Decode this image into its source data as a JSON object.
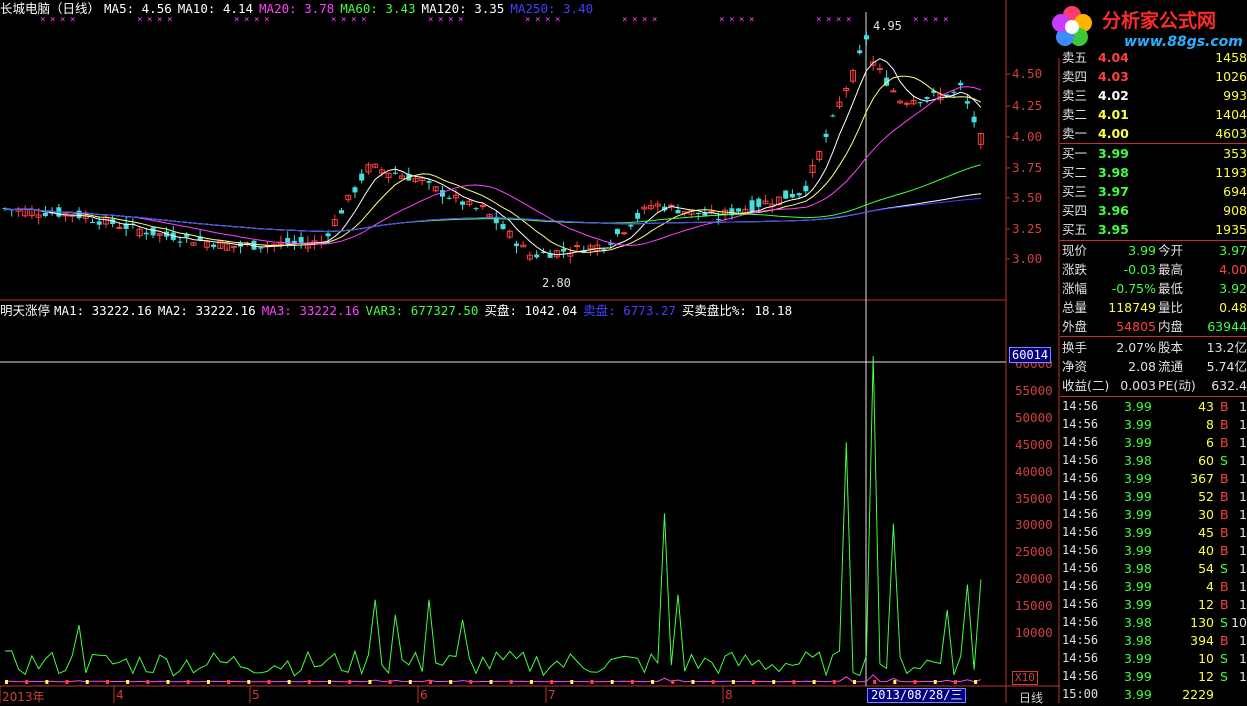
{
  "header": {
    "title": "长城电脑（日线）",
    "ma": [
      {
        "label": "MA5: 4.56",
        "color": "#ffffff"
      },
      {
        "label": "MA10: 4.14",
        "color": "#ffffff"
      },
      {
        "label": "MA20: 3.78",
        "color": "#ff40ff"
      },
      {
        "label": "MA60: 3.43",
        "color": "#40ff40"
      },
      {
        "label": "MA120: 3.35",
        "color": "#ffffff"
      },
      {
        "label": "MA250: 3.40",
        "color": "#4040ff"
      }
    ]
  },
  "indicator": {
    "name": "明天涨停",
    "items": [
      {
        "label": "MA1: 33222.16",
        "color": "#ffffff"
      },
      {
        "label": "MA2: 33222.16",
        "color": "#ffffff"
      },
      {
        "label": "MA3: 33222.16",
        "color": "#ff40ff"
      },
      {
        "label": "VAR3: 677327.50",
        "color": "#40ff40"
      },
      {
        "label": "买盘: 1042.04",
        "color": "#ffffff"
      },
      {
        "label": "卖盘: 6773.27",
        "color": "#4040ff"
      },
      {
        "label": "买卖盘比%: 18.18",
        "color": "#ffffff"
      }
    ]
  },
  "price_axis": [
    "4.50",
    "4.25",
    "4.00",
    "3.75",
    "3.50",
    "3.25",
    "3.00"
  ],
  "volume_axis": [
    "60000",
    "55000",
    "50000",
    "45000",
    "40000",
    "35000",
    "30000",
    "25000",
    "20000",
    "15000",
    "10000"
  ],
  "crosshair_value": "60014",
  "zoom_label": "X10",
  "period_label": "日线",
  "x_axis": [
    "2013年",
    "4",
    "5",
    "6",
    "7",
    "8"
  ],
  "cursor_date": "2013/08/28/三",
  "annotations": {
    "high": "4.95",
    "low": "2.80"
  },
  "logo": {
    "name": "分析家公式网",
    "url": "www.88gs.com"
  },
  "order_book": {
    "sell": [
      {
        "label": "卖五",
        "price": "4.04",
        "vol": "1458"
      },
      {
        "label": "卖四",
        "price": "4.03",
        "vol": "1026"
      },
      {
        "label": "卖三",
        "price": "4.02",
        "vol": "993"
      },
      {
        "label": "卖二",
        "price": "4.01",
        "vol": "1404"
      },
      {
        "label": "卖一",
        "price": "4.00",
        "vol": "4603"
      }
    ],
    "buy": [
      {
        "label": "买一",
        "price": "3.99",
        "vol": "353"
      },
      {
        "label": "买二",
        "price": "3.98",
        "vol": "1193"
      },
      {
        "label": "买三",
        "price": "3.97",
        "vol": "694"
      },
      {
        "label": "买四",
        "price": "3.96",
        "vol": "908"
      },
      {
        "label": "买五",
        "price": "3.95",
        "vol": "1935"
      }
    ]
  },
  "quote": [
    {
      "l1": "现价",
      "v1": "3.99",
      "c1": "#40ff40",
      "l2": "今开",
      "v2": "3.97",
      "c2": "#40ff40"
    },
    {
      "l1": "涨跌",
      "v1": "-0.03",
      "c1": "#40ff40",
      "l2": "最高",
      "v2": "4.00",
      "c2": "#ff4040"
    },
    {
      "l1": "涨幅",
      "v1": "-0.75%",
      "c1": "#40ff40",
      "l2": "最低",
      "v2": "3.92",
      "c2": "#40ff40"
    },
    {
      "l1": "总量",
      "v1": "118749",
      "c1": "#ffff40",
      "l2": "量比",
      "v2": "0.48",
      "c2": "#ffff40"
    },
    {
      "l1": "外盘",
      "v1": "54805",
      "c1": "#ff4040",
      "l2": "内盘",
      "v2": "63944",
      "c2": "#40ff40"
    }
  ],
  "stats": [
    {
      "l1": "换手",
      "v1": "2.07%",
      "l2": "股本",
      "v2": "13.2亿"
    },
    {
      "l1": "净资",
      "v1": "2.08",
      "l2": "流通",
      "v2": "5.74亿"
    },
    {
      "l1": "收益(二)",
      "v1": "0.003",
      "l2": "PE(动)",
      "v2": "632.4"
    }
  ],
  "ticks": [
    {
      "time": "14:56",
      "price": "3.99",
      "vol": "43",
      "side": "B",
      "extra": "1"
    },
    {
      "time": "14:56",
      "price": "3.99",
      "vol": "8",
      "side": "B",
      "extra": "1"
    },
    {
      "time": "14:56",
      "price": "3.99",
      "vol": "6",
      "side": "B",
      "extra": "1"
    },
    {
      "time": "14:56",
      "price": "3.98",
      "vol": "60",
      "side": "S",
      "extra": "1"
    },
    {
      "time": "14:56",
      "price": "3.99",
      "vol": "367",
      "side": "B",
      "extra": "1"
    },
    {
      "time": "14:56",
      "price": "3.99",
      "vol": "52",
      "side": "B",
      "extra": "1"
    },
    {
      "time": "14:56",
      "price": "3.99",
      "vol": "30",
      "side": "B",
      "extra": "1"
    },
    {
      "time": "14:56",
      "price": "3.99",
      "vol": "45",
      "side": "B",
      "extra": "1"
    },
    {
      "time": "14:56",
      "price": "3.99",
      "vol": "40",
      "side": "B",
      "extra": "1"
    },
    {
      "time": "14:56",
      "price": "3.98",
      "vol": "54",
      "side": "S",
      "extra": "1"
    },
    {
      "time": "14:56",
      "price": "3.99",
      "vol": "4",
      "side": "B",
      "extra": "1"
    },
    {
      "time": "14:56",
      "price": "3.99",
      "vol": "12",
      "side": "B",
      "extra": "1"
    },
    {
      "time": "14:56",
      "price": "3.98",
      "vol": "130",
      "side": "S",
      "extra": "10"
    },
    {
      "time": "14:56",
      "price": "3.98",
      "vol": "394",
      "side": "B",
      "extra": "1"
    },
    {
      "time": "14:56",
      "price": "3.99",
      "vol": "10",
      "side": "S",
      "extra": "1"
    },
    {
      "time": "14:56",
      "price": "3.99",
      "vol": "12",
      "side": "S",
      "extra": "1"
    },
    {
      "time": "15:00",
      "price": "3.99",
      "vol": "2229",
      "side": "",
      "extra": ""
    }
  ]
}
